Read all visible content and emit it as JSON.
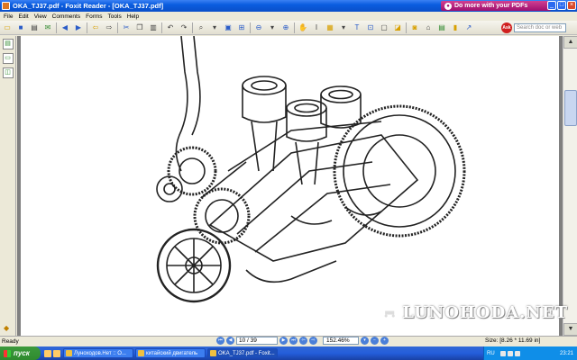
{
  "window": {
    "title": "OKA_TJ37.pdf - Foxit Reader - [OKA_TJ37.pdf]",
    "promo": "Do more with your PDFs",
    "buttons": [
      "_",
      "□",
      "×"
    ]
  },
  "menu": [
    "File",
    "Edit",
    "View",
    "Comments",
    "Forms",
    "Tools",
    "Help"
  ],
  "toolbar": {
    "search_placeholder": "Search doc or web",
    "search_logo": "Ask"
  },
  "navigation": {
    "page_value": "10 / 39",
    "zoom_value": "152.46%"
  },
  "status": {
    "ready": "Ready",
    "size": "Size: [8.26 * 11.69 in]"
  },
  "watermark": {
    "text": "LUNOHODA.NET"
  },
  "taskbar": {
    "start_label": "пуск",
    "tasks": [
      {
        "label": "Луноходов.Нет :: О..."
      },
      {
        "label": "китайский двигатель"
      },
      {
        "label": "OKA_TJ37.pdf - Foxit..."
      }
    ],
    "language": "RU",
    "clock": "23:21"
  },
  "colors": {
    "titlebar": "#0a5de0",
    "promo": "#c02080",
    "taskbar": "#245edb",
    "start": "#2f8a2f",
    "tray": "#0f8ee8"
  }
}
